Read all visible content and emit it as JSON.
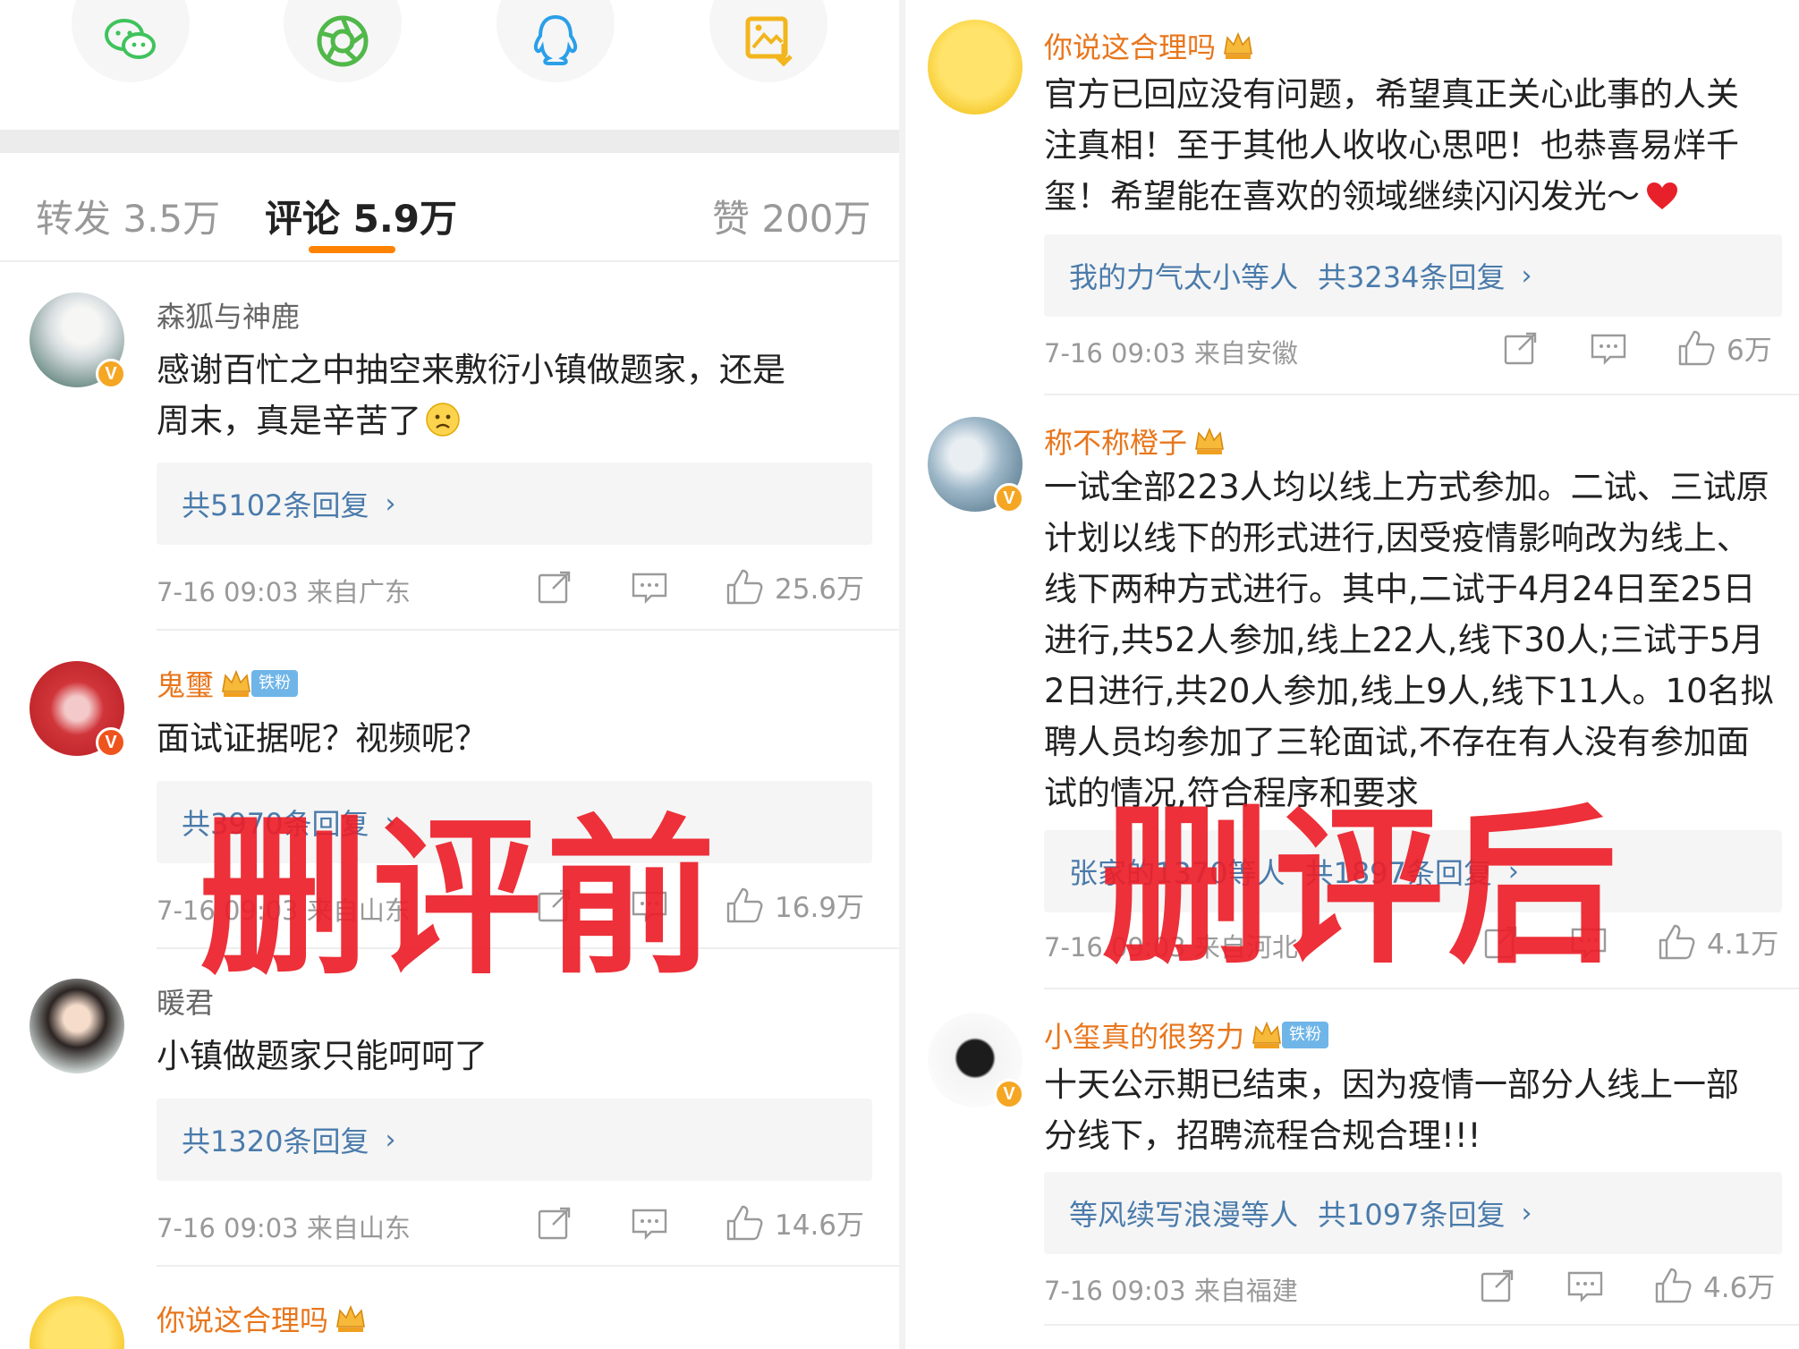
{
  "left": {
    "tabs": {
      "repost": "转发 3.5万",
      "comments": "评论 5.9万",
      "likes": "赞 200万"
    },
    "comments": [
      {
        "user": "森狐与神鹿",
        "text_lines": [
          "感谢百忙之中抽空来敷衍小镇做题家，还是",
          "周末，真是辛苦了"
        ],
        "reply": "共5102条回复",
        "meta": "7-16 09:03 来自广东",
        "likes": "25.6万"
      },
      {
        "user": "鬼璽",
        "badge": "铁粉",
        "text_lines": [
          "面试证据呢？视频呢？"
        ],
        "reply": "共3970条回复",
        "meta": "7-16 09:03 来自山东",
        "likes": "16.9万"
      },
      {
        "user": "暖君",
        "text_lines": [
          "小镇做题家只能呵呵了"
        ],
        "reply": "共1320条回复",
        "meta": "7-16 09:03 来自山东",
        "likes": "14.6万"
      },
      {
        "user": "你说这合理吗"
      }
    ],
    "overlay": "删评前"
  },
  "right": {
    "comments": [
      {
        "user": "你说这合理吗",
        "text_lines": [
          "官方已回应没有问题，希望真正关心此事的人关",
          "注真相！至于其他人收收心思吧！也恭喜易烊千",
          "玺！希望能在喜欢的领域继续闪闪发光～"
        ],
        "reply_users": "我的力气太小等人",
        "reply": "共3234条回复",
        "meta": "7-16 09:03 来自安徽",
        "likes": "6万"
      },
      {
        "user": "称不称橙子",
        "text_lines": [
          "一试全部223人均以线上方式参加。二试、三试原",
          "计划以线下的形式进行,因受疫情影响改为线上、",
          "线下两种方式进行。其中,二试于4月24日至25日",
          "进行,共52人参加,线上22人,线下30人;三试于5月",
          "2日进行,共20人参加,线上9人,线下11人。10名拟",
          "聘人员均参加了三轮面试,不存在有人没有参加面",
          "试的情况,符合程序和要求"
        ],
        "reply_users": "张家的1370等人",
        "reply": "共1897条回复",
        "meta": "7-16 09:03 来自河北",
        "likes": "4.1万"
      },
      {
        "user": "小玺真的很努力",
        "badge": "铁粉",
        "text_lines": [
          "十天公示期已结束，因为疫情一部分人线上一部",
          "分线下，招聘流程合规合理!!!"
        ],
        "reply_users": "等风续写浪漫等人",
        "reply": "共1097条回复",
        "meta": "7-16 09:03 来自福建",
        "likes": "4.6万"
      }
    ],
    "overlay": "删评后"
  },
  "colors": {
    "accent_orange": "#ff8200",
    "link_blue": "#4a7bab",
    "overlay_red": "#eb1e28"
  },
  "icons": [
    "wechat-icon",
    "moments-icon",
    "qq-icon",
    "save-image-icon",
    "repost-icon",
    "comment-icon",
    "like-icon",
    "verified-icon",
    "crown-icon",
    "heart-icon"
  ]
}
